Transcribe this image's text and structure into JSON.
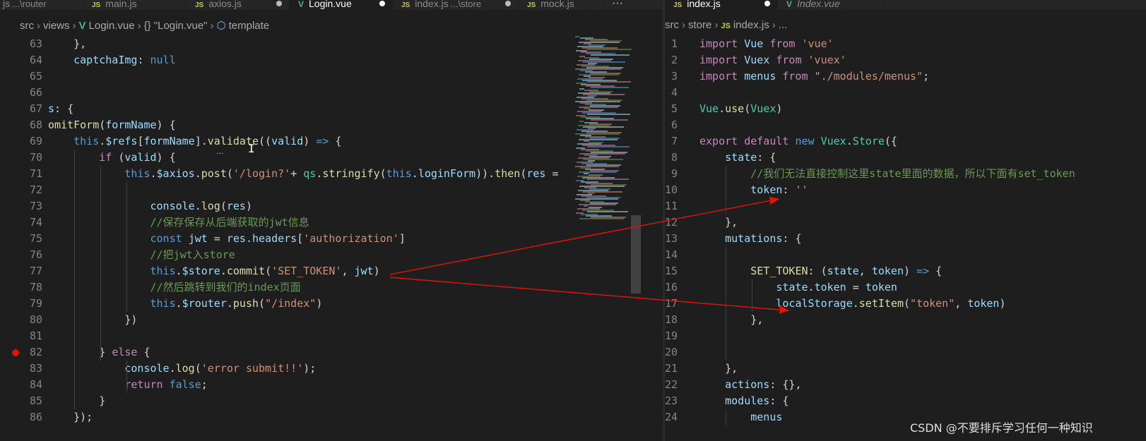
{
  "left": {
    "tabs": [
      {
        "label": "js",
        "desc": "...\\router",
        "icon": "",
        "active": false,
        "dirty": false
      },
      {
        "label": "main.js",
        "desc": "",
        "icon": "JS",
        "active": false,
        "dirty": false
      },
      {
        "label": "axios.js",
        "desc": "",
        "icon": "JS",
        "active": false,
        "dirty": true
      },
      {
        "label": "Login.vue",
        "desc": "",
        "icon": "V",
        "active": true,
        "dirty": true
      },
      {
        "label": "index.js",
        "desc": "...\\store",
        "icon": "JS",
        "active": false,
        "dirty": true
      },
      {
        "label": "mock.js",
        "desc": "",
        "icon": "JS",
        "active": false,
        "dirty": false
      }
    ],
    "more": "···",
    "breadcrumb": {
      "parts": [
        "src",
        "views",
        "Login.vue",
        "{} \"Login.vue\"",
        "template"
      ]
    },
    "lines": [
      {
        "n": "63",
        "c": [
          [
            "p",
            "    },"
          ]
        ]
      },
      {
        "n": "64",
        "c": [
          [
            "v",
            "    captchaImg"
          ],
          [
            "p",
            ": "
          ],
          [
            "b",
            "null"
          ]
        ]
      },
      {
        "n": "65",
        "c": []
      },
      {
        "n": "66",
        "c": []
      },
      {
        "n": "67",
        "c": [
          [
            "v",
            "s"
          ],
          [
            "p",
            ": {"
          ]
        ]
      },
      {
        "n": "68",
        "c": [
          [
            "f",
            "omitForm"
          ],
          [
            "p",
            "("
          ],
          [
            "v",
            "formName"
          ],
          [
            "p",
            ") {"
          ]
        ]
      },
      {
        "n": "69",
        "c": [
          [
            "k",
            "    this"
          ],
          [
            "p",
            "."
          ],
          [
            "v",
            "$refs"
          ],
          [
            "p",
            "["
          ],
          [
            "v",
            "formName"
          ],
          [
            "p",
            "]."
          ],
          [
            "f",
            "validate"
          ],
          [
            "p",
            "(("
          ],
          [
            "v",
            "valid"
          ],
          [
            "p",
            ") "
          ],
          [
            "k",
            "=>"
          ],
          [
            "p",
            " {"
          ]
        ]
      },
      {
        "n": "70",
        "c": [
          [
            "c",
            "        if"
          ],
          [
            "p",
            " ("
          ],
          [
            "v",
            "valid"
          ],
          [
            "p",
            ") {"
          ]
        ]
      },
      {
        "n": "71",
        "c": [
          [
            "k",
            "            this"
          ],
          [
            "p",
            "."
          ],
          [
            "v",
            "$axios"
          ],
          [
            "p",
            "."
          ],
          [
            "f",
            "post"
          ],
          [
            "p",
            "("
          ],
          [
            "s",
            "'/login?'"
          ],
          [
            "p",
            "+ "
          ],
          [
            "t",
            "qs"
          ],
          [
            "p",
            "."
          ],
          [
            "f",
            "stringify"
          ],
          [
            "p",
            "("
          ],
          [
            "k",
            "this"
          ],
          [
            "p",
            "."
          ],
          [
            "v",
            "loginForm"
          ],
          [
            "p",
            "))."
          ],
          [
            "f",
            "then"
          ],
          [
            "p",
            "("
          ],
          [
            "v",
            "res"
          ],
          [
            "p",
            " ="
          ]
        ]
      },
      {
        "n": "72",
        "c": []
      },
      {
        "n": "73",
        "c": [
          [
            "v",
            "                console"
          ],
          [
            "p",
            "."
          ],
          [
            "f",
            "log"
          ],
          [
            "p",
            "("
          ],
          [
            "v",
            "res"
          ],
          [
            "p",
            ")"
          ]
        ]
      },
      {
        "n": "74",
        "c": [
          [
            "m",
            "                //保存保存从后端获取的jwt信息"
          ]
        ]
      },
      {
        "n": "75",
        "c": [
          [
            "k",
            "                const"
          ],
          [
            "p",
            " "
          ],
          [
            "v",
            "jwt"
          ],
          [
            "p",
            " = "
          ],
          [
            "v",
            "res"
          ],
          [
            "p",
            "."
          ],
          [
            "v",
            "headers"
          ],
          [
            "p",
            "["
          ],
          [
            "s",
            "'authorization'"
          ],
          [
            "p",
            "]"
          ]
        ]
      },
      {
        "n": "76",
        "c": [
          [
            "m",
            "                //把jwt入store"
          ]
        ]
      },
      {
        "n": "77",
        "c": [
          [
            "k",
            "                this"
          ],
          [
            "p",
            "."
          ],
          [
            "v",
            "$store"
          ],
          [
            "p",
            "."
          ],
          [
            "f",
            "commit"
          ],
          [
            "p",
            "("
          ],
          [
            "s",
            "'SET_TOKEN'"
          ],
          [
            "p",
            ", "
          ],
          [
            "v",
            "jwt"
          ],
          [
            "p",
            ")"
          ]
        ]
      },
      {
        "n": "78",
        "c": [
          [
            "m",
            "                //然后跳转到我们的index页面"
          ]
        ]
      },
      {
        "n": "79",
        "c": [
          [
            "k",
            "                this"
          ],
          [
            "p",
            "."
          ],
          [
            "v",
            "$router"
          ],
          [
            "p",
            "."
          ],
          [
            "f",
            "push"
          ],
          [
            "p",
            "("
          ],
          [
            "s",
            "\"/index\""
          ],
          [
            "p",
            ")"
          ]
        ]
      },
      {
        "n": "80",
        "c": [
          [
            "p",
            "            })"
          ]
        ]
      },
      {
        "n": "81",
        "c": []
      },
      {
        "n": "82",
        "c": [
          [
            "p",
            "        } "
          ],
          [
            "c",
            "else"
          ],
          [
            "p",
            " {"
          ]
        ],
        "breakpoint": true
      },
      {
        "n": "83",
        "c": [
          [
            "v",
            "            console"
          ],
          [
            "p",
            "."
          ],
          [
            "f",
            "log"
          ],
          [
            "p",
            "("
          ],
          [
            "s",
            "'error submit!!'"
          ],
          [
            "p",
            ");"
          ]
        ]
      },
      {
        "n": "84",
        "c": [
          [
            "c",
            "            return"
          ],
          [
            "p",
            " "
          ],
          [
            "b",
            "false"
          ],
          [
            "p",
            ";"
          ]
        ]
      },
      {
        "n": "85",
        "c": [
          [
            "p",
            "        }"
          ]
        ]
      },
      {
        "n": "86",
        "c": [
          [
            "p",
            "    });"
          ]
        ]
      }
    ]
  },
  "right": {
    "tabs": [
      {
        "label": "index.js",
        "desc": "",
        "icon": "JS",
        "active": true,
        "dirty": true
      },
      {
        "label": "Index.vue",
        "desc": "",
        "icon": "V",
        "active": false,
        "dirty": false,
        "italic": true
      }
    ],
    "breadcrumb": {
      "parts": [
        "src",
        "store",
        "index.js",
        "..."
      ]
    },
    "lines": [
      {
        "n": "1",
        "c": [
          [
            "c",
            "import"
          ],
          [
            "p",
            " "
          ],
          [
            "v",
            "Vue"
          ],
          [
            "p",
            " "
          ],
          [
            "c",
            "from"
          ],
          [
            "p",
            " "
          ],
          [
            "s",
            "'vue'"
          ]
        ]
      },
      {
        "n": "2",
        "c": [
          [
            "c",
            "import"
          ],
          [
            "p",
            " "
          ],
          [
            "v",
            "Vuex"
          ],
          [
            "p",
            " "
          ],
          [
            "c",
            "from"
          ],
          [
            "p",
            " "
          ],
          [
            "s",
            "'vuex'"
          ]
        ]
      },
      {
        "n": "3",
        "c": [
          [
            "c",
            "import"
          ],
          [
            "p",
            " "
          ],
          [
            "v",
            "menus"
          ],
          [
            "p",
            " "
          ],
          [
            "c",
            "from"
          ],
          [
            "p",
            " "
          ],
          [
            "s",
            "\"./modules/menus\""
          ],
          [
            "p",
            ";"
          ]
        ]
      },
      {
        "n": "4",
        "c": []
      },
      {
        "n": "5",
        "c": [
          [
            "t",
            "Vue"
          ],
          [
            "p",
            "."
          ],
          [
            "f",
            "use"
          ],
          [
            "p",
            "("
          ],
          [
            "t",
            "Vuex"
          ],
          [
            "p",
            ")"
          ]
        ]
      },
      {
        "n": "6",
        "c": []
      },
      {
        "n": "7",
        "c": [
          [
            "c",
            "export"
          ],
          [
            "p",
            " "
          ],
          [
            "c",
            "default"
          ],
          [
            "p",
            " "
          ],
          [
            "k",
            "new"
          ],
          [
            "p",
            " "
          ],
          [
            "t",
            "Vuex"
          ],
          [
            "p",
            "."
          ],
          [
            "t",
            "Store"
          ],
          [
            "p",
            "({"
          ]
        ]
      },
      {
        "n": "8",
        "c": [
          [
            "v",
            "    state"
          ],
          [
            "p",
            ": {"
          ]
        ]
      },
      {
        "n": "9",
        "c": [
          [
            "m",
            "        //我们无法直接控制这里state里面的数据，所以下面有set_token"
          ]
        ]
      },
      {
        "n": "10",
        "c": [
          [
            "v",
            "        token"
          ],
          [
            "p",
            ": "
          ],
          [
            "s",
            "''"
          ]
        ]
      },
      {
        "n": "11",
        "c": []
      },
      {
        "n": "12",
        "c": [
          [
            "p",
            "    },"
          ]
        ]
      },
      {
        "n": "13",
        "c": [
          [
            "v",
            "    mutations"
          ],
          [
            "p",
            ": {"
          ]
        ]
      },
      {
        "n": "14",
        "c": []
      },
      {
        "n": "15",
        "c": [
          [
            "f",
            "        SET_TOKEN"
          ],
          [
            "p",
            ": ("
          ],
          [
            "v",
            "state"
          ],
          [
            "p",
            ", "
          ],
          [
            "v",
            "token"
          ],
          [
            "p",
            ") "
          ],
          [
            "k",
            "=>"
          ],
          [
            "p",
            " {"
          ]
        ]
      },
      {
        "n": "16",
        "c": [
          [
            "v",
            "            state"
          ],
          [
            "p",
            "."
          ],
          [
            "v",
            "token"
          ],
          [
            "p",
            " = "
          ],
          [
            "v",
            "token"
          ]
        ]
      },
      {
        "n": "17",
        "c": [
          [
            "v",
            "            localStorage"
          ],
          [
            "p",
            "."
          ],
          [
            "f",
            "setItem"
          ],
          [
            "p",
            "("
          ],
          [
            "s",
            "\"token\""
          ],
          [
            "p",
            ", "
          ],
          [
            "v",
            "token"
          ],
          [
            "p",
            ")"
          ]
        ]
      },
      {
        "n": "18",
        "c": [
          [
            "p",
            "        },"
          ]
        ]
      },
      {
        "n": "19",
        "c": []
      },
      {
        "n": "20",
        "c": []
      },
      {
        "n": "21",
        "c": [
          [
            "p",
            "    },"
          ]
        ]
      },
      {
        "n": "22",
        "c": [
          [
            "v",
            "    actions"
          ],
          [
            "p",
            ": {},"
          ]
        ]
      },
      {
        "n": "23",
        "c": [
          [
            "v",
            "    modules"
          ],
          [
            "p",
            ": {"
          ]
        ]
      },
      {
        "n": "24",
        "c": [
          [
            "v",
            "        menus"
          ]
        ]
      }
    ]
  },
  "watermark": "CSDN @不要排斥学习任何一种知识",
  "annotation_color": "#e51400"
}
